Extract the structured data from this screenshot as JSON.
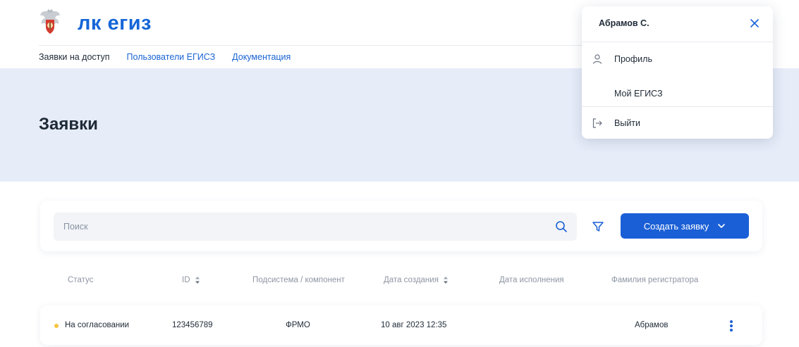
{
  "header": {
    "brand": "лк егиз",
    "nav": [
      {
        "label": "Заявки на доступ",
        "current": true
      },
      {
        "label": "Пользователи ЕГИСЗ",
        "current": false
      },
      {
        "label": "Документация",
        "current": false
      }
    ]
  },
  "hero": {
    "title": "Заявки"
  },
  "toolbar": {
    "search_placeholder": "Поиск",
    "search_value": "",
    "create_label": "Создать заявку"
  },
  "table": {
    "columns": [
      "Статус",
      "ID",
      "Подсистема / компонент",
      "Дата создания",
      "Дата исполнения",
      "Фамилия регистратора"
    ],
    "rows": [
      {
        "status": "На согласовании",
        "id": "123456789",
        "subsystem": "ФРМО",
        "created": "10 авг 2023  12:35",
        "executed": "",
        "registrar": "Абрамов"
      }
    ]
  },
  "user_menu": {
    "name": "Абрамов С.",
    "items": [
      {
        "label": "Профиль",
        "icon": "person-icon"
      },
      {
        "label": "Мой ЕГИСЗ",
        "icon": ""
      },
      {
        "label": "Выйти",
        "icon": "logout-icon"
      }
    ]
  },
  "colors": {
    "accent": "#1a5fd6",
    "brand": "#1566d8",
    "hero_bg": "#e6ecf8",
    "status_pending": "#f5c542"
  }
}
